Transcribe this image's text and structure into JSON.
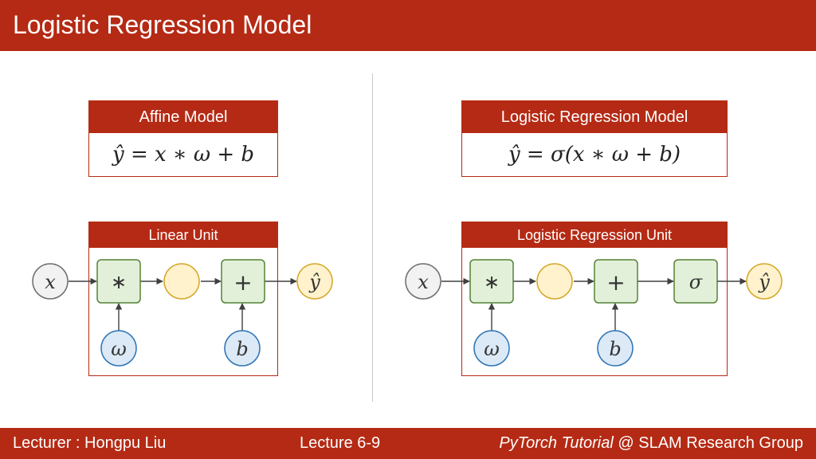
{
  "header": {
    "title": "Logistic Regression Model"
  },
  "left": {
    "formula_box": {
      "title": "Affine Model",
      "formula": "ŷ = x ∗ ω + b"
    },
    "unit": {
      "title": "Linear Unit",
      "input": "x",
      "ops": [
        "∗",
        "+"
      ],
      "weight": "ω",
      "bias": "b",
      "output": "ŷ"
    }
  },
  "right": {
    "formula_box": {
      "title": "Logistic Regression Model",
      "formula": "ŷ = σ(x ∗ ω + b)"
    },
    "unit": {
      "title": "Logistic Regression Unit",
      "input": "x",
      "ops": [
        "∗",
        "+",
        "σ"
      ],
      "weight": "ω",
      "bias": "b",
      "output": "ŷ"
    }
  },
  "footer": {
    "lecturer": "Lecturer : Hongpu Liu",
    "lecture": "Lecture 6-9",
    "group_italic": "PyTorch Tutorial",
    "group_rest": " @ SLAM Research Group"
  },
  "colors": {
    "brand_red": "#b52a14",
    "input_fill": "#f2f2f2",
    "input_stroke": "#6e6e6e",
    "op_fill": "#e2f0d9",
    "op_stroke": "#548235",
    "mid_fill": "#fff2cc",
    "mid_stroke": "#d6a728",
    "param_fill": "#dce9f6",
    "param_stroke": "#2e75b6"
  }
}
